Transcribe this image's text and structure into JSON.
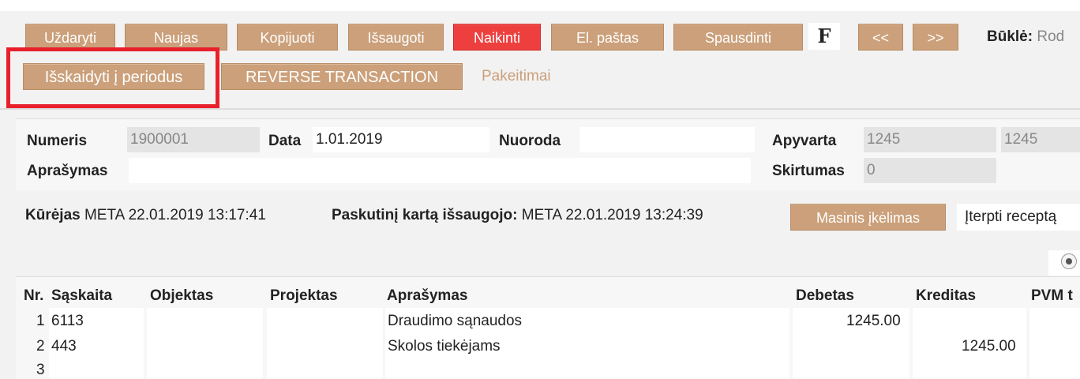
{
  "toolbar": {
    "buttons": [
      "Uždaryti",
      "Naujas",
      "Kopijuoti",
      "Išsaugoti",
      "Naikinti",
      "El. paštas",
      "Spausdinti"
    ],
    "f_label": "F",
    "prev": "<<",
    "next": ">>",
    "status_label": "Būklė:",
    "status_value": "Rod",
    "split_button": "Išskaidyti į periodus",
    "reverse_button": "REVERSE TRANSACTION",
    "changes_link": "Pakeitimai"
  },
  "header": {
    "numeris_label": "Numeris",
    "numeris_value": "1900001",
    "data_label": "Data",
    "data_value": "1.01.2019",
    "nuoroda_label": "Nuoroda",
    "nuoroda_value": "",
    "apyvarta_label": "Apyvarta",
    "apyvarta_debit": "1245",
    "apyvarta_credit": "1245",
    "aprasymas_label": "Aprašymas",
    "aprasymas_value": "",
    "skirtumas_label": "Skirtumas",
    "skirtumas_value": "0"
  },
  "meta": {
    "creator_label": "Kūrėjas",
    "creator_value": "META 22.01.2019 13:17:41",
    "saved_label": "Paskutinį kartą išsaugojo:",
    "saved_value": "META 22.01.2019 13:24:39",
    "mass_import": "Masinis įkėlimas",
    "insert_recipe": "Įterpti receptą"
  },
  "grid": {
    "columns": [
      "Nr.",
      "Sąskaita",
      "Objektas",
      "Projektas",
      "Aprašymas",
      "Debetas",
      "Kreditas",
      "PVM t"
    ],
    "rows": [
      {
        "nr": "1",
        "account": "6113",
        "object": "",
        "project": "",
        "description": "Draudimo sąnaudos",
        "debit": "1245.00",
        "credit": ""
      },
      {
        "nr": "2",
        "account": "443",
        "object": "",
        "project": "",
        "description": "Skolos tiekėjams",
        "debit": "",
        "credit": "1245.00"
      },
      {
        "nr": "3",
        "account": "",
        "object": "",
        "project": "",
        "description": "",
        "debit": "",
        "credit": ""
      }
    ]
  },
  "colors": {
    "button": "#cba07a",
    "delete_button": "#ee3f3f",
    "highlight": "#e8202c"
  }
}
